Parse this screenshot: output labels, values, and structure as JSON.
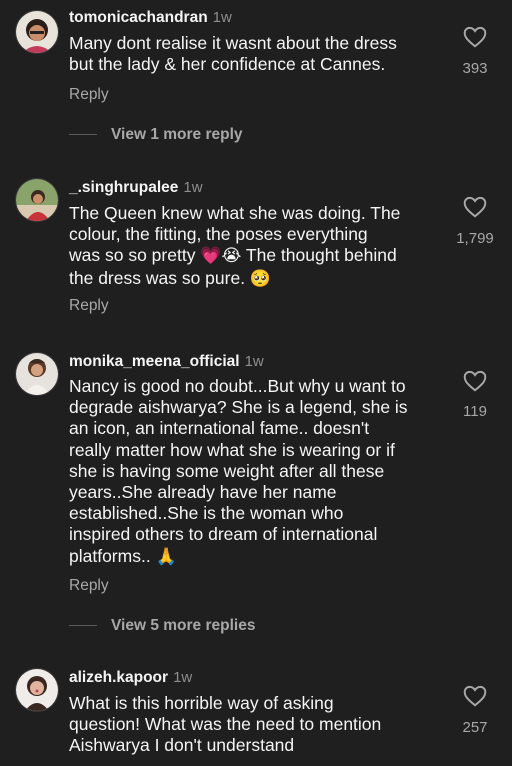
{
  "comments": [
    {
      "username": "tomonicachandran",
      "time": "1w",
      "lines": [
        "Many dont realise it wasnt about the dress",
        "but the lady & her confidence at Cannes."
      ],
      "likes": "393",
      "reply_label": "Reply",
      "more_replies": "View 1 more reply"
    },
    {
      "username": "_.singhrupalee",
      "time": "1w",
      "line1": "The Queen knew what she was doing. The",
      "line2": "colour, the fitting, the poses everything",
      "line3a": "was so so pretty ",
      "emoji_heart": "💗",
      "emoji_tears": "😭",
      "line3b": " The thought behind",
      "line4": "the dress was so pure. ",
      "emoji_plead": "🥺",
      "likes": "1,799",
      "reply_label": "Reply"
    },
    {
      "username": "monika_meena_official",
      "time": "1w",
      "lines": [
        "Nancy is good no doubt...But why u want to",
        "degrade aishwarya? She is a legend, she is",
        "an icon, an international fame.. doesn't",
        "really matter how what she is wearing or if",
        "she is having some weight after all these",
        "years..She already have her name",
        "established..She is the woman who",
        "inspired others to dream of international"
      ],
      "last_line": "platforms.. ",
      "emoji_pray": "🙏",
      "likes": "119",
      "reply_label": "Reply",
      "more_replies": "View 5 more replies"
    },
    {
      "username": "alizeh.kapoor",
      "time": "1w",
      "lines": [
        "What is this horrible way of asking",
        "question! What was the need to mention",
        "Aishwarya I don't understand"
      ],
      "likes": "257"
    }
  ],
  "icons": {
    "like": "heart-outline-icon",
    "avatar": "profile-avatar"
  },
  "colors": {
    "background": "#1f1f1f",
    "text": "#f5f5f5",
    "muted": "#a8a8a8",
    "time": "#8e8e8e"
  }
}
